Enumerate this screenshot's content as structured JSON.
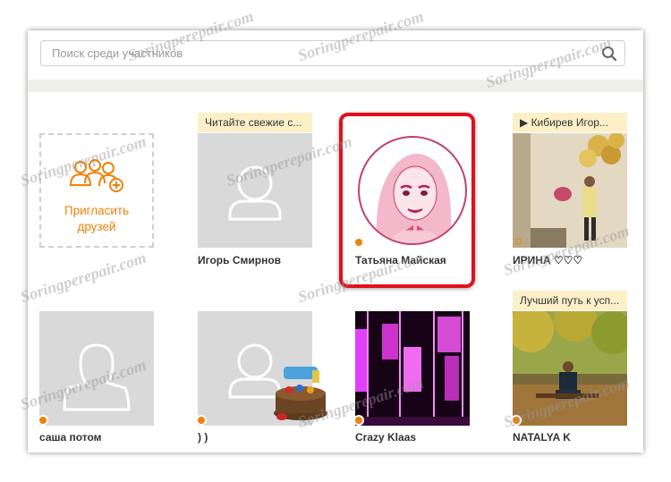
{
  "search": {
    "placeholder": "Поиск среди участников"
  },
  "invite": {
    "label_line1": "Пригласить",
    "label_line2": "друзей"
  },
  "members": [
    {
      "name": "Игорь Смирнов",
      "tag": "Читайте свежие с...",
      "online": false
    },
    {
      "name": "Татьяна Майская",
      "online": true
    },
    {
      "name": "ИРИНА ♡♡♡",
      "tag": "▶ Кибирев Игор...",
      "online": true
    },
    {
      "name": "саша потом",
      "online": true
    },
    {
      "name": ") )",
      "online": true
    },
    {
      "name": "Crazy Klaas",
      "online": true
    },
    {
      "name": "NATALYA K",
      "tag": "Лучший путь к усп...",
      "online": true
    }
  ],
  "watermark": "Soringperepair.com",
  "colors": {
    "accent": "#ee8208",
    "highlight": "#e0101c",
    "placeholder_bg": "#d9d9d9"
  }
}
